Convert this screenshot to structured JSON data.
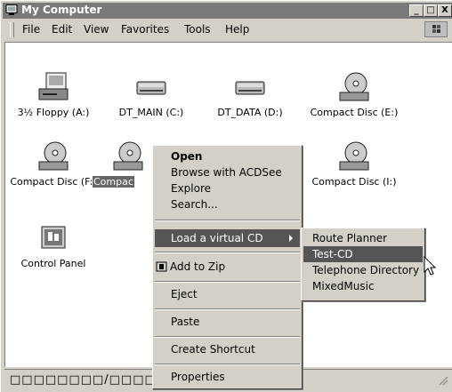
{
  "window": {
    "title": "My Computer",
    "controls": [
      "_",
      "□",
      "X"
    ]
  },
  "menubar": [
    "File",
    "Edit",
    "View",
    "Favorites",
    "Tools",
    "Help"
  ],
  "drives": [
    {
      "label": "3½ Floppy (A:)",
      "icon": "floppy-drive-icon"
    },
    {
      "label": "DT_MAIN (C:)",
      "icon": "hard-drive-icon"
    },
    {
      "label": "DT_DATA (D:)",
      "icon": "hard-drive-icon"
    },
    {
      "label": "Compact Disc (E:)",
      "icon": "cd-drive-icon"
    },
    {
      "label": "Compact Disc (F:)",
      "icon": "cd-drive-icon"
    },
    {
      "label": "Compac",
      "icon": "cd-drive-icon",
      "selected": true
    },
    {
      "label": "Compact Disc (I:)",
      "icon": "cd-drive-icon"
    },
    {
      "label": "Control Panel",
      "icon": "control-panel-icon"
    }
  ],
  "context_menu": {
    "open": "Open",
    "browse": "Browse with ACDSee",
    "explore": "Explore",
    "search": "Search...",
    "load_virtual_cd": "Load a virtual CD",
    "add_to_zip": "Add to Zip",
    "eject": "Eject",
    "paste": "Paste",
    "create_shortcut": "Create Shortcut",
    "properties": "Properties"
  },
  "submenu": [
    "Route Planner",
    "Test-CD",
    "Telephone Directory",
    "MixedMusic"
  ],
  "statusbar": {
    "text": "□□□□□□□□/□□□□"
  }
}
